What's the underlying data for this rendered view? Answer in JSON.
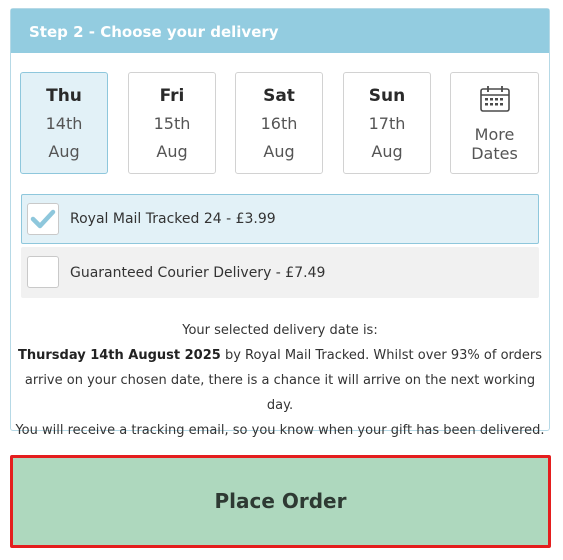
{
  "step": {
    "title": "Step 2 - Choose your delivery"
  },
  "dates": [
    {
      "day": "Thu",
      "date": "14th",
      "month": "Aug",
      "selected": true
    },
    {
      "day": "Fri",
      "date": "15th",
      "month": "Aug",
      "selected": false
    },
    {
      "day": "Sat",
      "date": "16th",
      "month": "Aug",
      "selected": false
    },
    {
      "day": "Sun",
      "date": "17th",
      "month": "Aug",
      "selected": false
    }
  ],
  "more_dates": {
    "line1": "More",
    "line2": "Dates",
    "icon": "calendar-icon"
  },
  "options": [
    {
      "label": "Royal Mail Tracked 24 - £3.99",
      "checked": true
    },
    {
      "label": "Guaranteed Courier Delivery - £7.49",
      "checked": false
    }
  ],
  "info": {
    "line1": "Your selected delivery date is:",
    "date_bold": "Thursday 14th August 2025",
    "line2_rest": " by Royal Mail Tracked. Whilst over 93% of orders",
    "line3": "arrive on your chosen date, there is a chance it will arrive on the next working day.",
    "line4": "You will receive a tracking email, so you know when your gift has been delivered."
  },
  "place_order": {
    "label": "Place Order"
  },
  "colors": {
    "header": "#93cce0",
    "selected_bg": "#e2f1f7",
    "check": "#8ec7dc",
    "button_bg": "#aed8be",
    "button_border": "#e41e1e"
  }
}
